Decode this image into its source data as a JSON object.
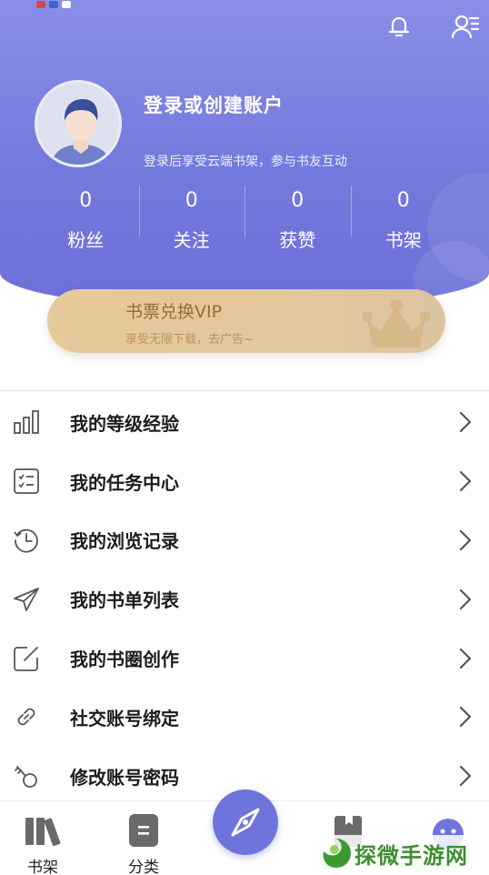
{
  "header": {
    "login_title": "登录或创建账户",
    "login_subtitle": "登录后享受云端书架，参与书友互动",
    "stats": [
      {
        "value": "0",
        "label": "粉丝"
      },
      {
        "value": "0",
        "label": "关注"
      },
      {
        "value": "0",
        "label": "获赞"
      },
      {
        "value": "0",
        "label": "书架"
      }
    ],
    "icons": [
      "bell-icon",
      "user-settings-icon"
    ]
  },
  "vip": {
    "title": "书票兑换VIP",
    "subtitle": "享受无限下载，去广告~",
    "icon": "crown-icon"
  },
  "menu": [
    {
      "label": "我的等级经验",
      "icon": "level-bars-icon"
    },
    {
      "label": "我的任务中心",
      "icon": "task-checklist-icon"
    },
    {
      "label": "我的浏览记录",
      "icon": "history-clock-icon"
    },
    {
      "label": "我的书单列表",
      "icon": "paper-plane-icon"
    },
    {
      "label": "我的书圈创作",
      "icon": "edit-square-icon"
    },
    {
      "label": "社交账号绑定",
      "icon": "link-icon"
    },
    {
      "label": "修改账号密码",
      "icon": "key-icon"
    }
  ],
  "tabbar": {
    "tabs": [
      {
        "label": "书架",
        "icon": "bookshelf-icon"
      },
      {
        "label": "分类",
        "icon": "category-icon"
      },
      {
        "label": "",
        "icon": "compass-icon"
      },
      {
        "label": "",
        "icon": "bookmark-book-icon"
      },
      {
        "label": "",
        "icon": "profile-face-icon"
      }
    ]
  },
  "watermark": {
    "text": "探微手游网"
  },
  "colors": {
    "header": "#7479dd",
    "accent": "#6f74dc",
    "vip_gold": "#e3c89c",
    "vip_text": "#9a6d37",
    "watermark_green": "#3c8f2f"
  }
}
